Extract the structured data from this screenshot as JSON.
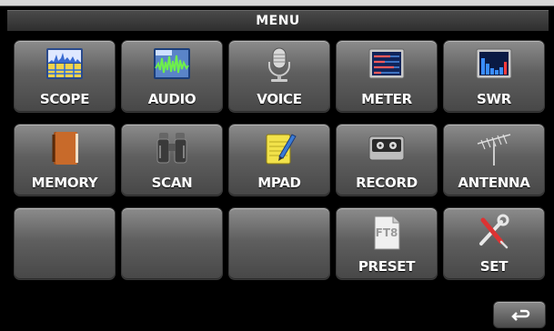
{
  "title": "MENU",
  "tiles": [
    {
      "label": "SCOPE",
      "icon": "scope-icon"
    },
    {
      "label": "AUDIO",
      "icon": "audio-icon"
    },
    {
      "label": "VOICE",
      "icon": "microphone-icon"
    },
    {
      "label": "METER",
      "icon": "meter-icon"
    },
    {
      "label": "SWR",
      "icon": "swr-icon"
    },
    {
      "label": "MEMORY",
      "icon": "memory-book-icon"
    },
    {
      "label": "SCAN",
      "icon": "binoculars-icon"
    },
    {
      "label": "MPAD",
      "icon": "notepad-pencil-icon"
    },
    {
      "label": "RECORD",
      "icon": "record-cassette-icon"
    },
    {
      "label": "ANTENNA",
      "icon": "antenna-icon"
    },
    {
      "label": "",
      "icon": ""
    },
    {
      "label": "",
      "icon": ""
    },
    {
      "label": "",
      "icon": ""
    },
    {
      "label": "PRESET",
      "icon": "ft8-preset-icon",
      "icon_text": "FT8"
    },
    {
      "label": "SET",
      "icon": "wrench-screwdriver-icon"
    }
  ],
  "back_button": {
    "icon": "return-arrow-icon"
  },
  "colors": {
    "tile_top": "#8c8c8c",
    "tile_bottom": "#474747",
    "background": "#000000"
  }
}
